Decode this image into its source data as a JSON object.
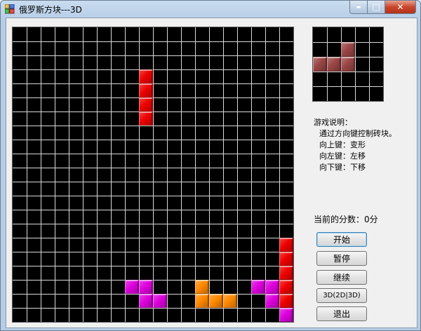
{
  "window": {
    "title": "俄罗斯方块---3D",
    "controls": {
      "minimize": "▬",
      "maximize": "□",
      "close": "✕"
    }
  },
  "board": {
    "cols": 20,
    "rows": 21,
    "grid_color": "#d8d8d8",
    "background": "#000000",
    "cells": [
      {
        "c": 9,
        "r": 3,
        "color": "#ee0000"
      },
      {
        "c": 9,
        "r": 4,
        "color": "#ee0000"
      },
      {
        "c": 9,
        "r": 5,
        "color": "#ee0000"
      },
      {
        "c": 9,
        "r": 6,
        "color": "#ee0000"
      },
      {
        "c": 19,
        "r": 15,
        "color": "#ee0000"
      },
      {
        "c": 19,
        "r": 16,
        "color": "#ee0000"
      },
      {
        "c": 19,
        "r": 17,
        "color": "#ee0000"
      },
      {
        "c": 19,
        "r": 18,
        "color": "#ee0000"
      },
      {
        "c": 19,
        "r": 19,
        "color": "#ee0000"
      },
      {
        "c": 8,
        "r": 18,
        "color": "#dd00dd"
      },
      {
        "c": 9,
        "r": 18,
        "color": "#dd00dd"
      },
      {
        "c": 9,
        "r": 19,
        "color": "#dd00dd"
      },
      {
        "c": 10,
        "r": 19,
        "color": "#dd00dd"
      },
      {
        "c": 17,
        "r": 18,
        "color": "#dd00dd"
      },
      {
        "c": 18,
        "r": 18,
        "color": "#dd00dd"
      },
      {
        "c": 18,
        "r": 19,
        "color": "#dd00dd"
      },
      {
        "c": 19,
        "r": 20,
        "color": "#dd00dd"
      },
      {
        "c": 13,
        "r": 18,
        "color": "#ff8800"
      },
      {
        "c": 13,
        "r": 19,
        "color": "#ff8800"
      },
      {
        "c": 14,
        "r": 19,
        "color": "#ff8800"
      },
      {
        "c": 15,
        "r": 19,
        "color": "#ff8800"
      }
    ]
  },
  "preview": {
    "cols": 5,
    "rows": 5,
    "grid_color": "#d8d8d8",
    "background": "#000000",
    "cells": [
      {
        "c": 2,
        "r": 1,
        "color": "#9b4545"
      },
      {
        "c": 0,
        "r": 2,
        "color": "#9b4545"
      },
      {
        "c": 1,
        "r": 2,
        "color": "#9b4545"
      },
      {
        "c": 2,
        "r": 2,
        "color": "#9b4545"
      }
    ]
  },
  "instructions": {
    "heading": "游戏说明：",
    "lines": [
      "通过方向键控制砖块。",
      "向上键：变形",
      "向左键：左移",
      "向下键：下移"
    ]
  },
  "score": {
    "label": "当前的分数：",
    "value": "0分"
  },
  "buttons": {
    "start": "开始",
    "pause": "暂停",
    "resume": "继续",
    "mode": "3D(2D|3D)",
    "exit": "退出"
  }
}
